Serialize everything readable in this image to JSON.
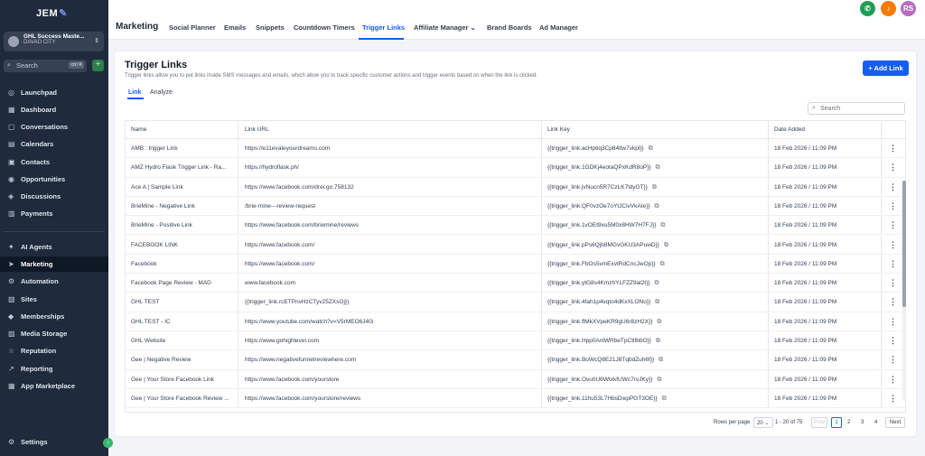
{
  "app": {
    "logo_text": "JEM",
    "account_name": "GHL Success Maste...",
    "account_city": "DAVAO CITY",
    "search_placeholder": "Search",
    "search_shortcut": "ctrl K"
  },
  "sidebar": {
    "items": [
      {
        "label": "Launchpad",
        "icon": "rocket-icon",
        "glyph": "◎",
        "active": false
      },
      {
        "label": "Dashboard",
        "icon": "dashboard-icon",
        "glyph": "▦",
        "active": false
      },
      {
        "label": "Conversations",
        "icon": "chat-icon",
        "glyph": "▢",
        "active": false
      },
      {
        "label": "Calendars",
        "icon": "calendar-icon",
        "glyph": "▤",
        "active": false
      },
      {
        "label": "Contacts",
        "icon": "contacts-icon",
        "glyph": "▣",
        "active": false
      },
      {
        "label": "Opportunities",
        "icon": "opportunities-icon",
        "glyph": "◉",
        "active": false
      },
      {
        "label": "Discussions",
        "icon": "discussions-icon",
        "glyph": "◈",
        "active": false
      },
      {
        "label": "Payments",
        "icon": "payments-icon",
        "glyph": "▥",
        "active": false
      },
      {
        "label": "AI Agents",
        "icon": "ai-agents-icon",
        "glyph": "✦",
        "active": false
      },
      {
        "label": "Marketing",
        "icon": "marketing-icon",
        "glyph": "➤",
        "active": true
      },
      {
        "label": "Automation",
        "icon": "automation-icon",
        "glyph": "⚙",
        "active": false
      },
      {
        "label": "Sites",
        "icon": "sites-icon",
        "glyph": "▧",
        "active": false
      },
      {
        "label": "Memberships",
        "icon": "memberships-icon",
        "glyph": "◆",
        "active": false
      },
      {
        "label": "Media Storage",
        "icon": "media-storage-icon",
        "glyph": "▨",
        "active": false
      },
      {
        "label": "Reputation",
        "icon": "star-icon",
        "glyph": "☆",
        "active": false
      },
      {
        "label": "Reporting",
        "icon": "reporting-icon",
        "glyph": "↗",
        "active": false
      },
      {
        "label": "App Marketplace",
        "icon": "marketplace-icon",
        "glyph": "▦",
        "active": false
      }
    ],
    "settings_label": "Settings"
  },
  "header": {
    "section_title": "Marketing",
    "tabs": [
      {
        "label": "Social Planner"
      },
      {
        "label": "Emails"
      },
      {
        "label": "Snippets"
      },
      {
        "label": "Countdown Timers"
      },
      {
        "label": "Trigger Links",
        "active": true
      },
      {
        "label": "Affiliate Manager ⌄"
      },
      {
        "label": "Brand Boards"
      },
      {
        "label": "Ad Manager"
      }
    ],
    "avatar_initials": "RS"
  },
  "page": {
    "title": "Trigger Links",
    "description": "Trigger links allow you to put links inside SMS messages and emails, which allow you to track specific customer actions and trigger events based on when the link is clicked.",
    "add_button": "Add Link",
    "subtabs": [
      "Link",
      "Analyze"
    ],
    "search_placeholder": "Search"
  },
  "table": {
    "columns": [
      "Name",
      "Link URL",
      "Link Key",
      "Date Added"
    ],
    "rows": [
      {
        "name": "AMB : trigger Link",
        "url": "https://e11evateyourdreams.com",
        "key": "{{trigger_link.acHptiq3Cp84ltw7vkpl}}",
        "date": "18 Feb 2026 / 11:09 PM"
      },
      {
        "name": "AMZ Hydro Flask Trigger Link - Ra...",
        "url": "https://hydroflask.ph/",
        "key": "{{trigger_link.1GDKj4eotaQPxKdR8oP}}",
        "date": "18 Feb 2026 / 11:09 PM"
      },
      {
        "name": "Ace A | Sample Link",
        "url": "https://www.facebook.com/drei.go.758132",
        "key": "{{trigger_link.jvNucn5R7CzLK7ldyGT}}",
        "date": "18 Feb 2026 / 11:09 PM"
      },
      {
        "name": "BrieMine - Negative Link",
        "url": "/brie-mine---review-request",
        "key": "{{trigger_link.QF0vzOe7oYtJCivVkAIe}}",
        "date": "18 Feb 2026 / 11:09 PM"
      },
      {
        "name": "BrieMine - Positive Link",
        "url": "https://www.facebook.com/briemine/reviews",
        "key": "{{trigger_link.1vOEt9xu5M0x8HW7H7FJ}}",
        "date": "18 Feb 2026 / 11:09 PM"
      },
      {
        "name": "FACEBOOK LINK",
        "url": "https://www.facebook.com/",
        "key": "{{trigger_link.pPs6Qjb8MGvGKU3APuwD}}",
        "date": "18 Feb 2026 / 11:09 PM"
      },
      {
        "name": "Facebook",
        "url": "https://www.facebook.com/",
        "key": "{{trigger_link.FbOs5vmExvtRdCncJwOp}}",
        "date": "18 Feb 2026 / 11:09 PM"
      },
      {
        "name": "Facebook Page Review - MAD",
        "url": "www.facebook.com",
        "key": "{{trigger_link.ytG8s4KmzhYLFZZ9al2t}}",
        "date": "18 Feb 2026 / 11:09 PM"
      },
      {
        "name": "GHL TEST",
        "url": "{{trigger_link.rcETPnvHzCTyv25ZXsOj}}",
        "key": "{{trigger_link.4fah1p4vqto4dKxXLONo}}",
        "date": "18 Feb 2026 / 11:09 PM"
      },
      {
        "name": "GHL TEST - IC",
        "url": "https://www.youtube.com/watch?v=V5rMEO6J40i",
        "key": "{{trigger_link.flMkXVpeKR9gU6r8zH2X}}",
        "date": "18 Feb 2026 / 11:09 PM"
      },
      {
        "name": "GHL Website",
        "url": "https://www.gohighlevel.com",
        "key": "{{trigger_link.Hpp0AnlWRbeTpCtlfbbO}}",
        "date": "18 Feb 2026 / 11:09 PM"
      },
      {
        "name": "Gee | Negative Review",
        "url": "https://www.negativefunnelreviewhere.com",
        "key": "{{trigger_link.BoWcQ8E21J8TqbdZuh6f}}",
        "date": "18 Feb 2026 / 11:09 PM"
      },
      {
        "name": "Gee | Your Store Facebook Link",
        "url": "https://www.facebook.com/yourstore",
        "key": "{{trigger_link.Ovu0U6WtxkfUWc7rvJKy}}",
        "date": "18 Feb 2026 / 11:09 PM"
      },
      {
        "name": "Gee | Your Store Facebook Review ...",
        "url": "https://www.facebook.com/yourstore/reviews",
        "key": "{{trigger_link.11hu53L7HbsDwpPGT3OE}}",
        "date": "18 Feb 2026 / 11:09 PM"
      }
    ]
  },
  "pagination": {
    "rows_per_page_label": "Rows per page",
    "rows_per_page": "20",
    "range": "1 - 20 of 75",
    "prev": "Prev",
    "pages": [
      "1",
      "2",
      "3",
      "4"
    ],
    "current_page": "1",
    "next": "Next"
  },
  "colors": {
    "sidebar_bg": "#1f2a3c",
    "accent": "#155eef",
    "phone_green": "#1f9d55",
    "bell_orange": "#f57c00",
    "avatar_purple": "#b66dbe"
  }
}
